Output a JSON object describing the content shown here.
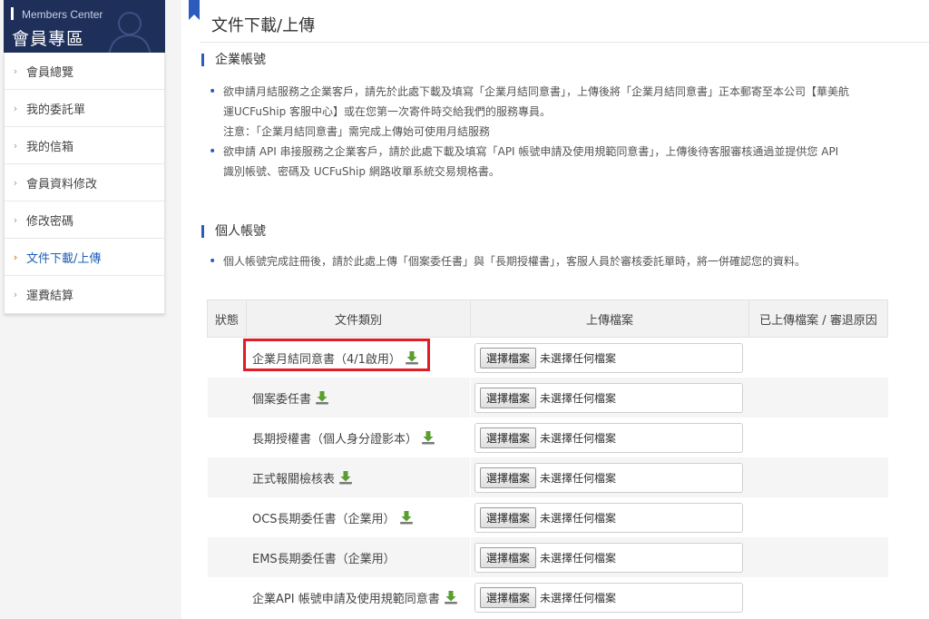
{
  "sidebar": {
    "title_en": "Members Center",
    "title_zh": "會員專區",
    "items": [
      {
        "label": "會員總覽"
      },
      {
        "label": "我的委託單"
      },
      {
        "label": "我的信箱"
      },
      {
        "label": "會員資料修改"
      },
      {
        "label": "修改密碼"
      },
      {
        "label": "文件下載/上傳"
      },
      {
        "label": "運費結算"
      }
    ]
  },
  "page": {
    "title": "文件下載/上傳"
  },
  "enterprise": {
    "heading": "企業帳號",
    "bullet1_line1": "欲申請月結服務之企業客戶，請先於此處下載及填寫「企業月結同意書」，上傳後將「企業月結同意書」正本郵寄至本公司【華美航",
    "bullet1_line2": "運UCFuShip 客服中心】或在您第一次寄件時交給我們的服務專員。",
    "bullet1_note": "注意：「企業月結同意書」需完成上傳始可使用月結服務",
    "bullet2_line1": "欲申請 API 串接服務之企業客戶，請於此處下載及填寫「API 帳號申請及使用規範同意書」，上傳後待客服審核通過並提供您 API",
    "bullet2_line2": "識別帳號、密碼及 UCFuShip 網路收單系統交易規格書。"
  },
  "personal": {
    "heading": "個人帳號",
    "bullet1": "個人帳號完成註冊後，請於此處上傳「個案委任書」與「長期授權書」，客服人員於審核委託單時，將一併確認您的資料。"
  },
  "table": {
    "headers": {
      "status": "狀態",
      "type": "文件類別",
      "upload": "上傳檔案",
      "uploaded": "已上傳檔案 / 審退原因"
    },
    "choose_label": "選擇檔案",
    "no_file_label": "未選擇任何檔案",
    "rows": [
      {
        "name": "企業月結同意書（4/1啟用）",
        "download": true
      },
      {
        "name": "個案委任書",
        "download": true
      },
      {
        "name": "長期授權書（個人身分證影本）",
        "download": true
      },
      {
        "name": "正式報關檢核表",
        "download": true
      },
      {
        "name": "OCS長期委任書（企業用）",
        "download": true
      },
      {
        "name": "EMS長期委任書（企業用）",
        "download": false
      },
      {
        "name": "企業API 帳號申請及使用規範同意書",
        "download": true
      }
    ]
  },
  "colors": {
    "navy": "#1e2f5a",
    "accent": "#2a5bbd",
    "highlight": "#e01c24",
    "download_green": "#5a9e2f"
  }
}
